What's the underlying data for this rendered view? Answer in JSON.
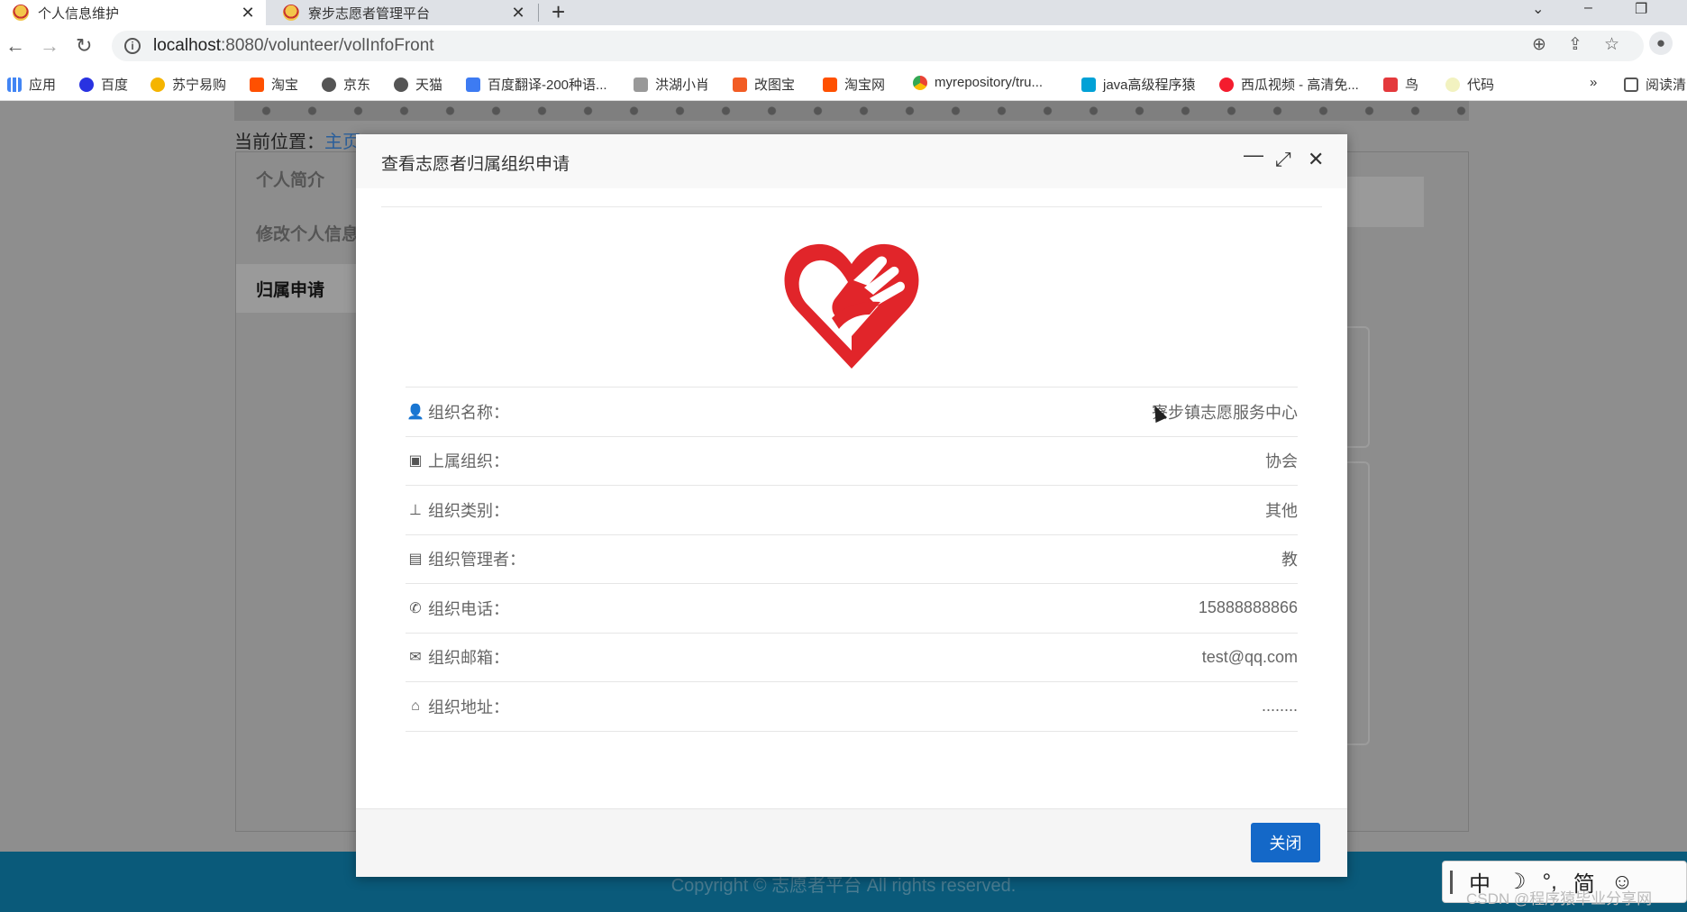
{
  "browser": {
    "tabs": [
      {
        "title": "个人信息维护",
        "active": true
      },
      {
        "title": "寮步志愿者管理平台",
        "active": false
      }
    ],
    "url_host": "localhost",
    "url_path": ":8080/volunteer/volInfoFront",
    "bookmarks": [
      "应用",
      "百度",
      "苏宁易购",
      "淘宝",
      "京东",
      "天猫",
      "百度翻译-200种语...",
      "洪湖小肖",
      "改图宝",
      "淘宝网",
      "myrepository/tru...",
      "java高级程序猿",
      "西瓜视频 - 高清免...",
      "鸟",
      "代码",
      "阅读清"
    ],
    "bookmark_more": "»"
  },
  "page": {
    "breadcrumb_label": "当前位置：",
    "breadcrumb_home": "主页",
    "nav_items": [
      "个人简介",
      "修改个人信息",
      "归属申请"
    ],
    "active_nav": "归属申请",
    "footer": "Copyright © 志愿者平台 All rights reserved."
  },
  "modal": {
    "title": "查看志愿者归属组织申请",
    "icons": {
      "minimize": "minimize-icon",
      "maximize": "maximize-icon",
      "close": "close-icon"
    },
    "rows": [
      {
        "icon": "user-icon",
        "label": "组织名称：",
        "value": "寮步镇志愿服务中心"
      },
      {
        "icon": "building-icon",
        "label": "上属组织：",
        "value": "协会"
      },
      {
        "icon": "sitemap-icon",
        "label": "组织类别：",
        "value": "其他"
      },
      {
        "icon": "id-card-icon",
        "label": "组织管理者：",
        "value": "教"
      },
      {
        "icon": "phone-icon",
        "label": "组织电话：",
        "value": "15888888866"
      },
      {
        "icon": "envelope-icon",
        "label": "组织邮箱：",
        "value": "test@qq.com"
      },
      {
        "icon": "home-icon",
        "label": "组织地址：",
        "value": "........"
      }
    ],
    "close_button": "关闭",
    "accent": "#1468c8",
    "logo_color": "#e1252a"
  },
  "ime": {
    "items": [
      "中",
      "☽",
      "°,",
      "简",
      "☺"
    ]
  },
  "watermark": "CSDN @程序猿毕业分享网"
}
